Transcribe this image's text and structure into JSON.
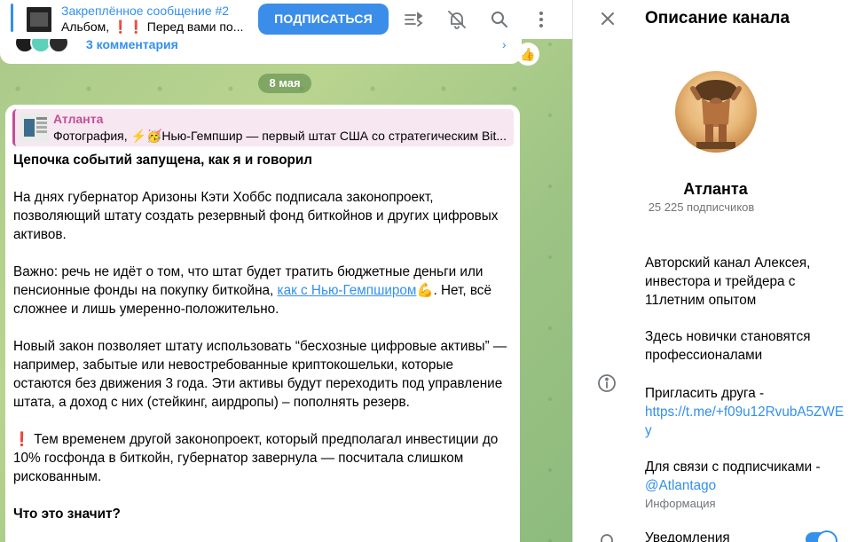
{
  "pinned": {
    "title": "Закреплённое сообщение #2",
    "subtitle": "Альбом, ❗❗ Перед вами по..."
  },
  "topbar": {
    "subscribe_label": "ПОДПИСАТЬСЯ",
    "icons": [
      "livestream-icon",
      "mute-bell-icon",
      "search-icon",
      "more-vertical-icon"
    ]
  },
  "previous_post": {
    "comments_label": "3 комментария",
    "reaction": "👍"
  },
  "date_separator": "8 мая",
  "message": {
    "reply": {
      "author": "Атланта",
      "preview": "Фотография, ⚡🥳Нью-Гемпшир — первый штат США со стратегическим Bit..."
    },
    "heading": "Цепочка событий запущена, как я и говорил",
    "p1": "На днях губернатор Аризоны Кэти Хоббс подписала законопроект, позволяющий штату создать резервный фонд биткойнов и других цифровых активов.",
    "p2_before": "Важно: речь не идёт о том, что штат будет тратить бюджетные деньги или пенсионные фонды на покупку биткойна, ",
    "p2_link": "как с Нью-Гемпширом",
    "p2_emoji": "💪",
    "p2_after": ". Нет, всё сложнее и лишь умеренно-положительно.",
    "p3": "Новый закон позволяет штату использовать “бесхозные цифровые активы” — например, забытые или невостребованные криптокошельки, которые остаются без движения 3 года. Эти активы будут переходить под управление штата, а доход с них (стейкинг, аирдропы) – пополнять резерв.",
    "p4_mark": "❗",
    "p4": " Тем временем другой законопроект, который предполагал инвестиции до 10% госфонда в биткойн, губернатор завернула — посчитала слишком рискованным.",
    "p5": "Что это значит?"
  },
  "panel": {
    "title": "Описание канала",
    "channel_name": "Атланта",
    "subscribers": "25 225 подписчиков",
    "desc1": "Авторский канал Алексея, инвестора и трейдера с 11летним опытом",
    "desc2": "Здесь новички становятся профессионалами",
    "invite_label": "Пригласить друга -",
    "invite_link": "https://t.me/+f09u12RvubA5ZWEy",
    "contact_label": "Для связи с подписчиками -",
    "contact_link": "@Atlantago",
    "info_caption": "Информация",
    "notifications_label": "Уведомления",
    "notifications_on": true
  },
  "colors": {
    "accent": "#3390ec",
    "reply_accent": "#c24f97"
  }
}
